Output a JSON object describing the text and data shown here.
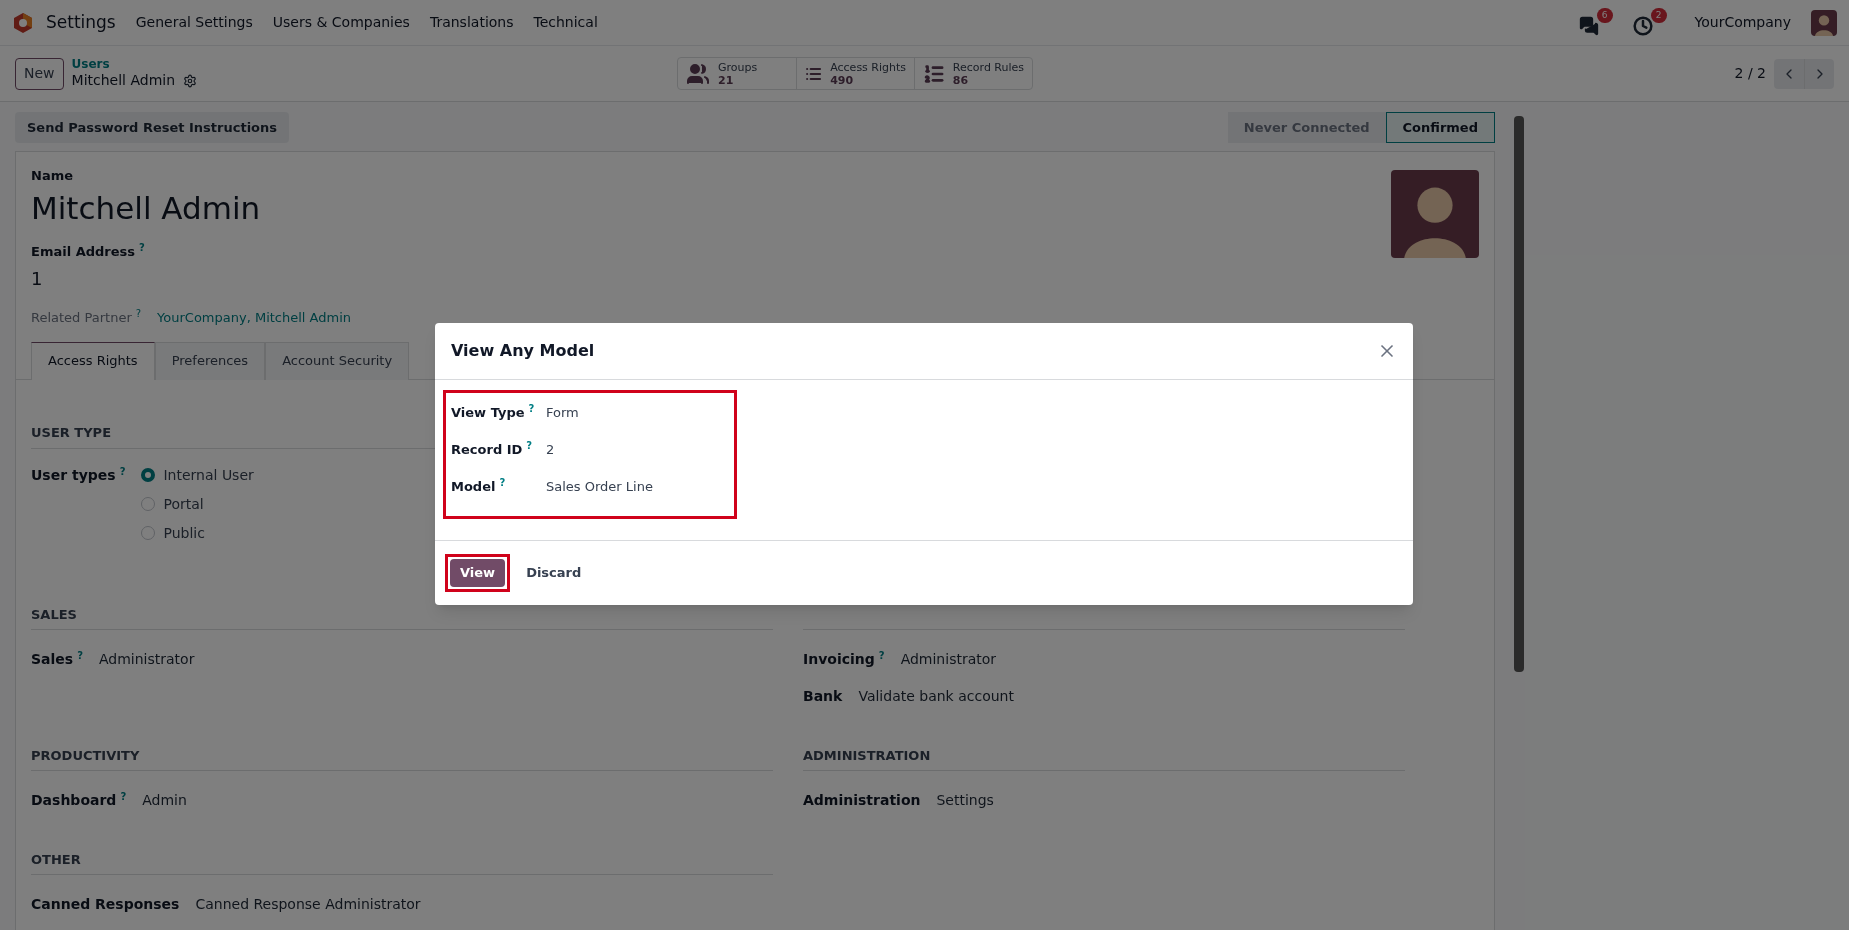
{
  "navbar": {
    "app": "Settings",
    "menus": [
      "General Settings",
      "Users & Companies",
      "Translations",
      "Technical"
    ],
    "messages_count": "6",
    "activities_count": "2",
    "company": "YourCompany"
  },
  "control_panel": {
    "new_button": "New",
    "breadcrumb": "Users",
    "record": "Mitchell Admin",
    "pager": "2 / 2",
    "stat_buttons": [
      {
        "kind": "groups",
        "label": "Groups",
        "value": "21"
      },
      {
        "kind": "list",
        "label": "Access Rights",
        "value": "490"
      },
      {
        "kind": "bullets",
        "label": "Record Rules",
        "value": "86"
      }
    ]
  },
  "action_button": "Send Password Reset Instructions",
  "status": [
    {
      "label": "Never Connected",
      "selected": false
    },
    {
      "label": "Confirmed",
      "selected": true
    }
  ],
  "form": {
    "name_label": "Name",
    "name": "Mitchell Admin",
    "email_label": "Email Address",
    "email_help": "?",
    "email": "1",
    "partner_label": "Related Partner",
    "partner_help": "?",
    "partner": "YourCompany, Mitchell Admin",
    "tabs": [
      {
        "label": "Access Rights",
        "selected": true
      },
      {
        "label": "Preferences",
        "selected": false
      },
      {
        "label": "Account Security",
        "selected": false
      }
    ],
    "user_type": {
      "title": "USER TYPE",
      "label": "User types",
      "help": "?",
      "options": [
        {
          "label": "Internal User",
          "selected": true
        },
        {
          "label": "Portal",
          "selected": false
        },
        {
          "label": "Public",
          "selected": false
        }
      ]
    },
    "left_sections": [
      {
        "title": "SALES",
        "fields": [
          {
            "label": "Sales",
            "help": "?",
            "value": "Administrator"
          }
        ]
      },
      {
        "title": "PRODUCTIVITY",
        "fields": [
          {
            "label": "Dashboard",
            "help": "?",
            "value": "Admin"
          }
        ]
      },
      {
        "title": "OTHER",
        "fields": [
          {
            "label": "Canned Responses",
            "value": "Canned Response Administrator"
          }
        ]
      }
    ],
    "right_sections": [
      {
        "fields": [
          {
            "label": "Invoicing",
            "help": "?",
            "value": "Administrator"
          },
          {
            "label": "Bank",
            "value": "Validate bank account"
          }
        ]
      },
      {
        "title": "ADMINISTRATION",
        "fields": [
          {
            "label": "Administration",
            "value": "Settings"
          }
        ]
      }
    ]
  },
  "dialog": {
    "title": "View Any Model",
    "fields": [
      {
        "label": "View Type",
        "help": "?",
        "value": "Form"
      },
      {
        "label": "Record ID",
        "help": "?",
        "value": "2"
      },
      {
        "label": "Model",
        "help": "?",
        "value": "Sales Order Line"
      }
    ],
    "buttons": [
      {
        "label": "View",
        "kind": "primary"
      },
      {
        "label": "Discard",
        "kind": "secondary"
      }
    ]
  }
}
